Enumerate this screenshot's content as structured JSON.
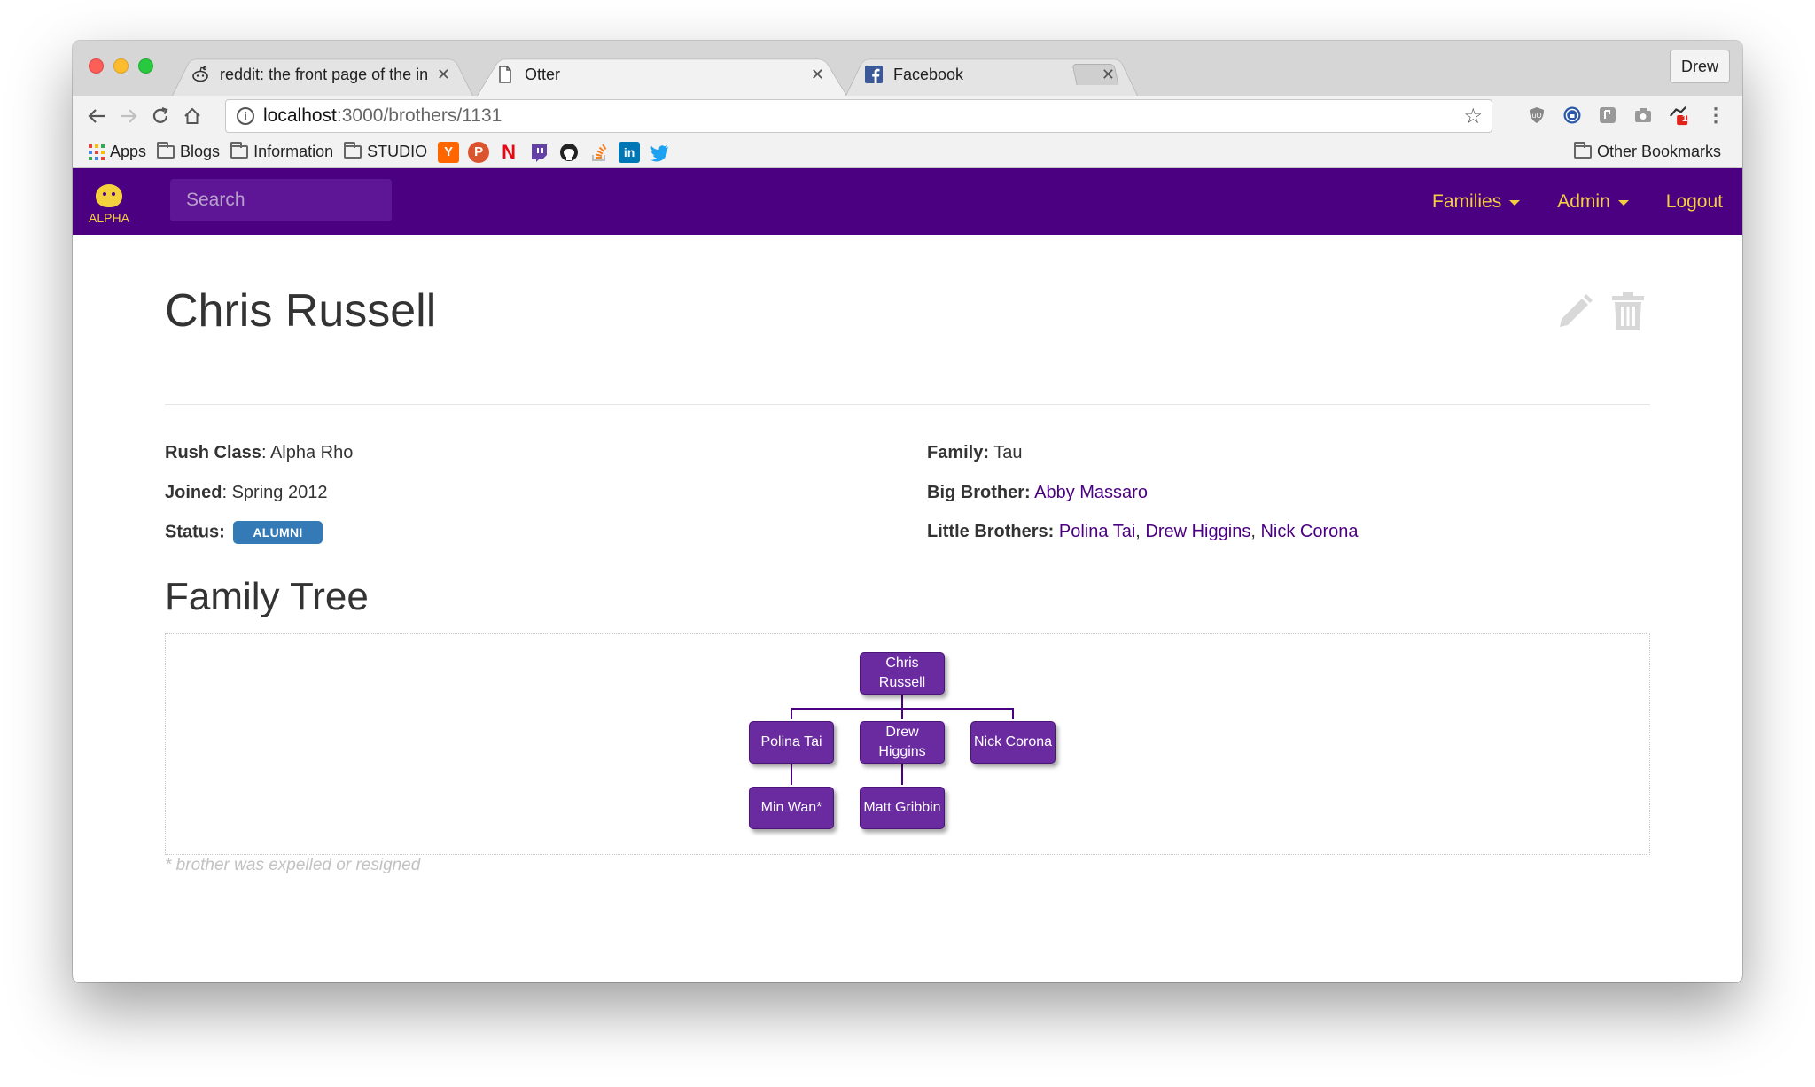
{
  "browser": {
    "tabs": [
      {
        "title": "reddit: the front page of the in"
      },
      {
        "title": "Otter"
      },
      {
        "title": "Facebook"
      }
    ],
    "profile": "Drew",
    "url_host": "localhost",
    "url_path": ":3000/brothers/1131",
    "bookmarks": {
      "apps": "Apps",
      "folders": [
        "Blogs",
        "Information",
        "STUDIO"
      ],
      "other": "Other Bookmarks"
    },
    "extension_badge": "1"
  },
  "navbar": {
    "brand": "ALPHA",
    "search_placeholder": "Search",
    "families": "Families",
    "admin": "Admin",
    "logout": "Logout"
  },
  "brother": {
    "name": "Chris Russell",
    "rush_class_label": "Rush Class",
    "rush_class": "Alpha Rho",
    "joined_label": "Joined",
    "joined": "Spring 2012",
    "status_label": "Status:",
    "status": "ALUMNI",
    "family_label": "Family:",
    "family": "Tau",
    "big_brother_label": "Big Brother:",
    "big_brother": "Abby Massaro",
    "little_brothers_label": "Little Brothers:",
    "little_brothers": [
      "Polina Tai",
      "Drew Higgins",
      "Nick Corona"
    ]
  },
  "family_tree": {
    "title": "Family Tree",
    "root": "Chris Russell",
    "children": [
      {
        "name": "Polina Tai",
        "children": [
          "Min Wan*"
        ]
      },
      {
        "name": "Drew Higgins",
        "children": [
          "Matt Gribbin"
        ]
      },
      {
        "name": "Nick Corona",
        "children": []
      }
    ],
    "footnote": "* brother was expelled or resigned"
  },
  "colors": {
    "brand_purple": "#4b0082",
    "brand_gold": "#f4d03f",
    "node_purple": "#6a2aa0",
    "badge_blue": "#337ab7"
  }
}
